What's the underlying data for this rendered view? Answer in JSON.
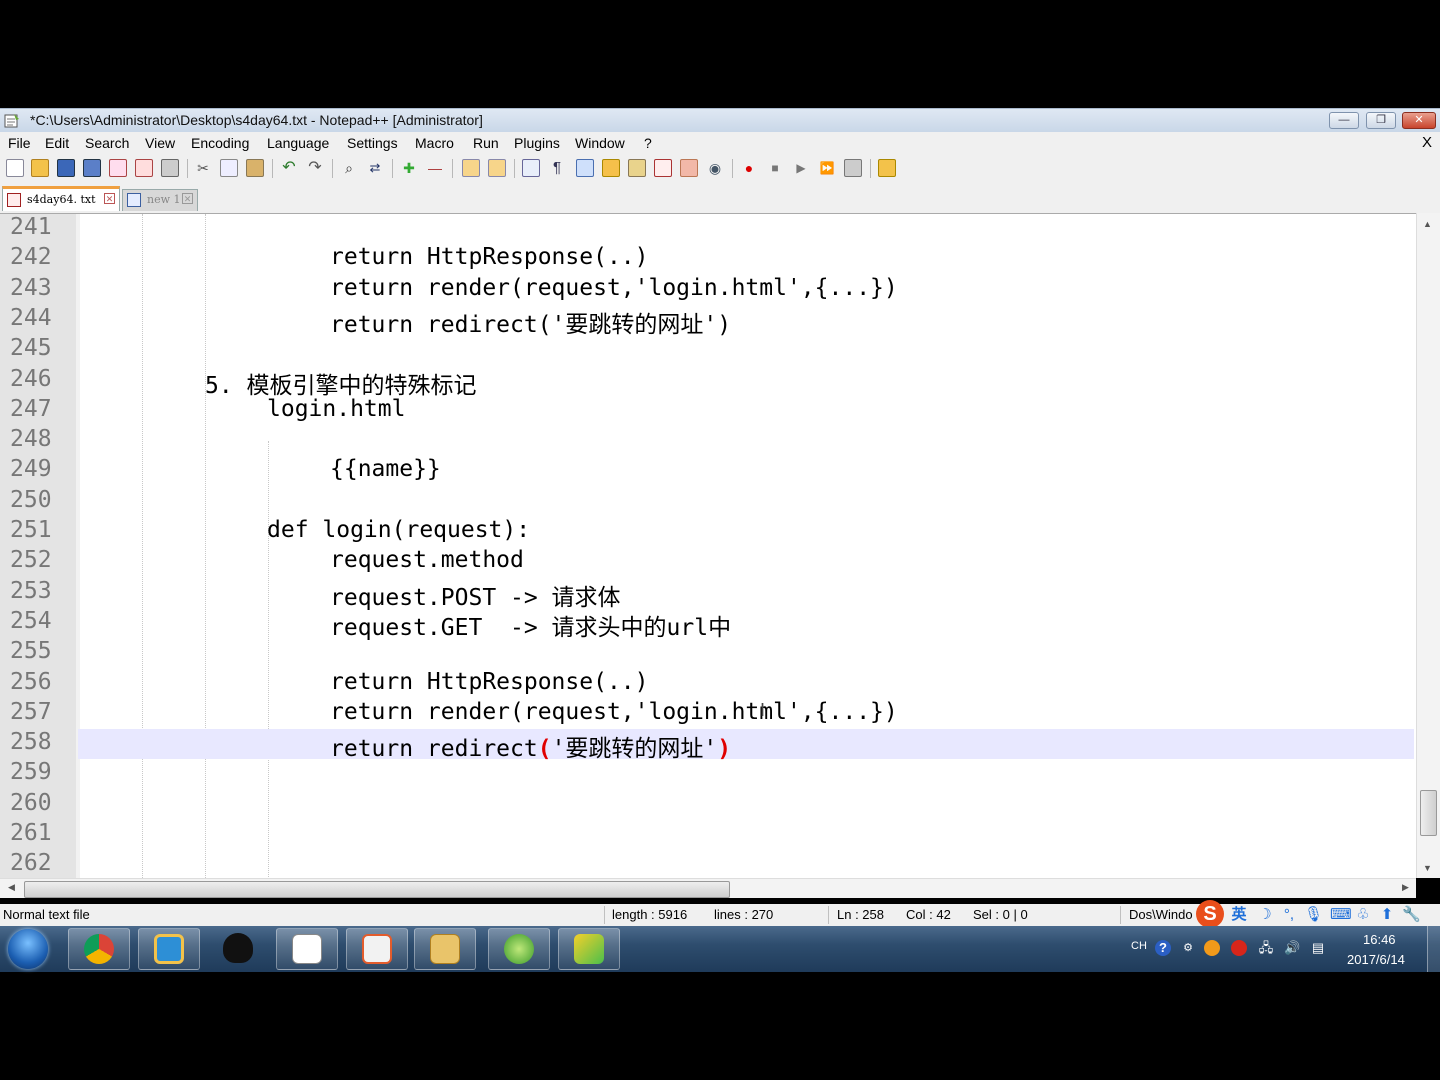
{
  "window": {
    "title": "*C:\\Users\\Administrator\\Desktop\\s4day64.txt - Notepad++ [Administrator]",
    "controls": [
      "—",
      "❐",
      "✕"
    ]
  },
  "menu": {
    "items": [
      "File",
      "Edit",
      "Search",
      "View",
      "Encoding",
      "Language",
      "Settings",
      "Macro",
      "Run",
      "Plugins",
      "Window",
      "?"
    ],
    "close": "X"
  },
  "tabs": [
    {
      "label": "s4day64. txt",
      "active": true
    },
    {
      "label": "new 1",
      "active": false
    }
  ],
  "editor": {
    "current_line": "258",
    "lines": [
      {
        "n": "241",
        "text": ""
      },
      {
        "n": "242",
        "text": "return HttpResponse(..)"
      },
      {
        "n": "243",
        "text": "return render(request,'login.html',{...})"
      },
      {
        "n": "244",
        "text": "return redirect('要跳转的网址')"
      },
      {
        "n": "245",
        "text": ""
      },
      {
        "n": "246",
        "text": "5. 模板引擎中的特殊标记"
      },
      {
        "n": "247",
        "text": "login.html"
      },
      {
        "n": "248",
        "text": ""
      },
      {
        "n": "249",
        "text": "{{name}}"
      },
      {
        "n": "250",
        "text": ""
      },
      {
        "n": "251",
        "text": "def login(request):"
      },
      {
        "n": "252",
        "text": "request.method"
      },
      {
        "n": "253",
        "text": "request.POST -> 请求体"
      },
      {
        "n": "254",
        "text": "request.GET  -> 请求头中的url中"
      },
      {
        "n": "255",
        "text": ""
      },
      {
        "n": "256",
        "text": "return HttpResponse(..)"
      },
      {
        "n": "257",
        "text": "return render(request,'login.html',{...})"
      },
      {
        "n": "258",
        "text_prefix": "return redirect",
        "text_open": "(",
        "text_mid": "'要跳转的网址'",
        "text_close": ")"
      },
      {
        "n": "259",
        "text": ""
      },
      {
        "n": "260",
        "text": ""
      },
      {
        "n": "261",
        "text": ""
      },
      {
        "n": "262",
        "text": ""
      }
    ]
  },
  "status": {
    "file_type": "Normal text file",
    "length": "length : 5916",
    "lines": "lines : 270",
    "ln": "Ln : 258",
    "col": "Col : 42",
    "sel": "Sel : 0 | 0",
    "eol": "Dos\\Windo"
  },
  "ime": {
    "logo": "S",
    "mode": "英"
  },
  "taskbar": {
    "apps": [
      "chrome-icon",
      "windows-explorer-icon",
      "qq-icon",
      "notepadpp-icon",
      "powerpoint-icon",
      "folder-icon",
      "python-icon",
      "pycharm-icon"
    ],
    "tray_lang": "CH",
    "time": "16:46",
    "date": "2017/6/14"
  },
  "colors": {
    "brace_highlight": "#e00000",
    "current_line": "#e8e8ff",
    "gutter": "#e4e4e4"
  }
}
